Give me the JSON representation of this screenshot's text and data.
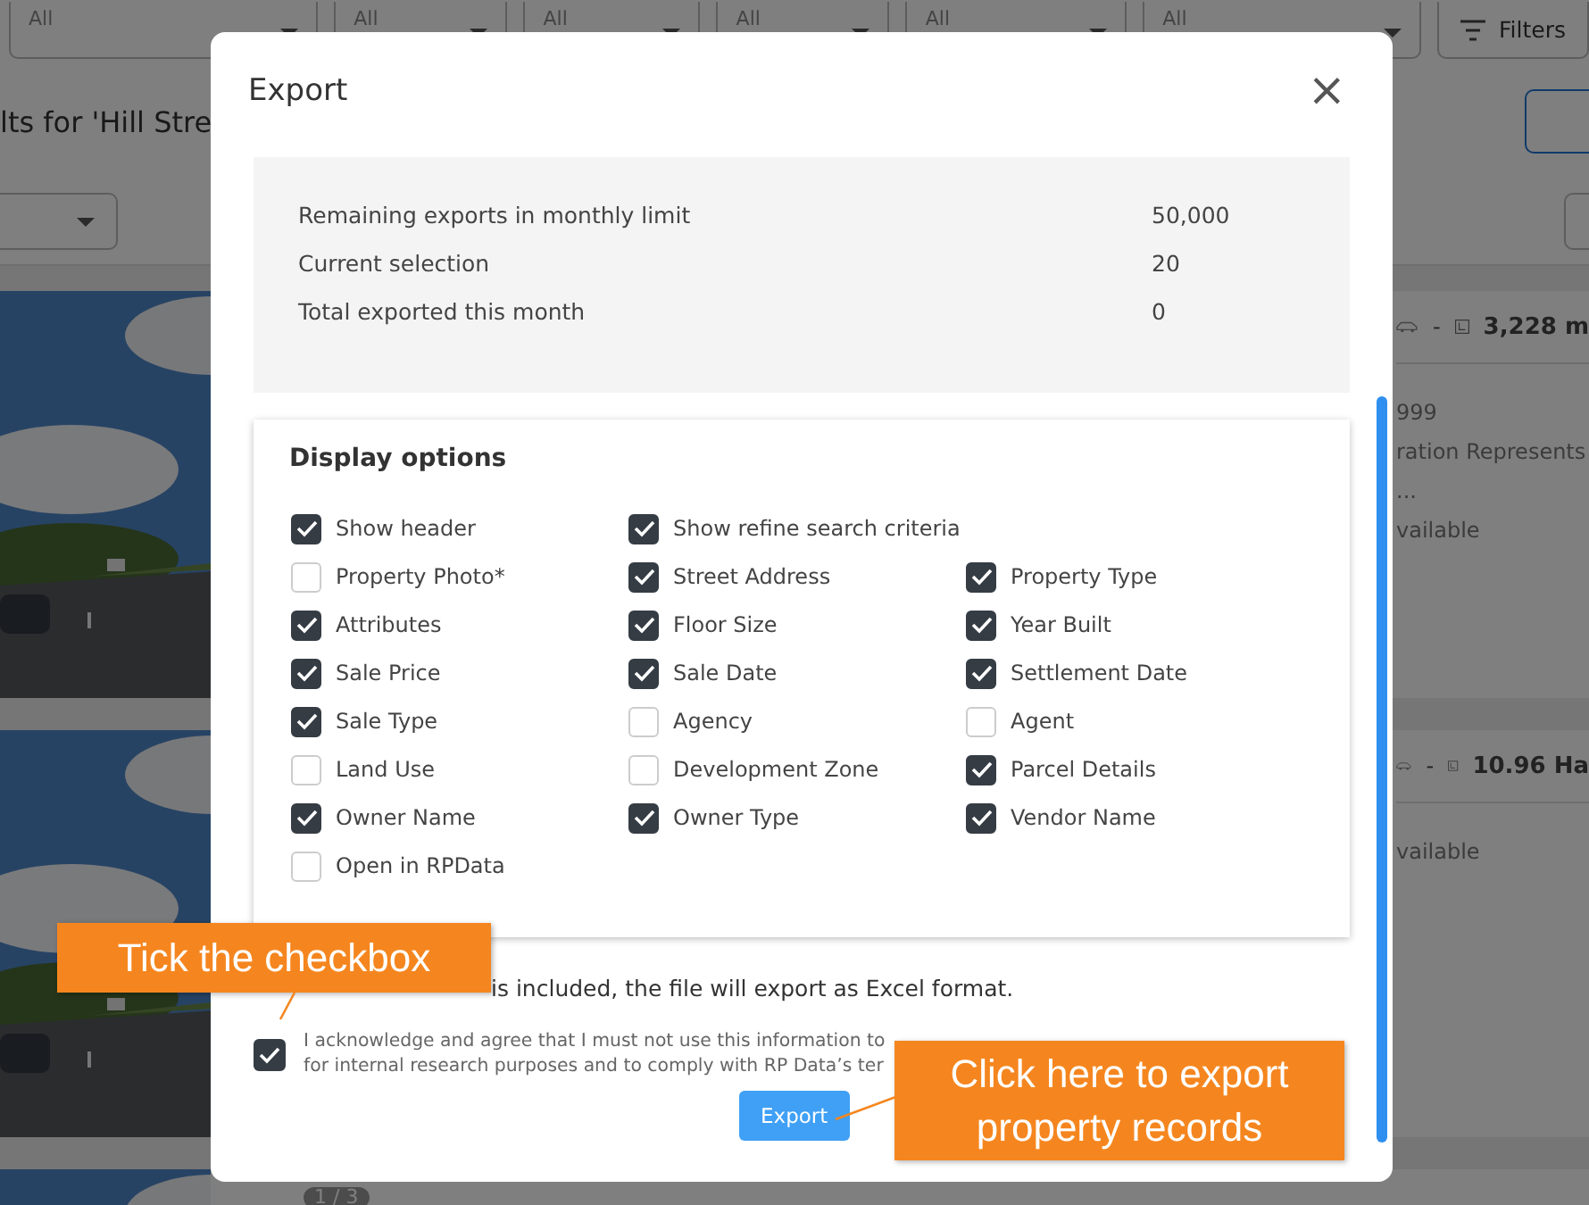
{
  "filters": [
    {
      "value": "All"
    },
    {
      "value": "All"
    },
    {
      "value": "All"
    },
    {
      "value": "All"
    },
    {
      "value": "All"
    },
    {
      "value": "All"
    }
  ],
  "filters_button": "Filters",
  "results_title": "lts for 'Hill Stre",
  "cards": [
    {
      "kind": "picture",
      "area": "3,228 m",
      "lines": [
        "999",
        "ration Represents",
        "...",
        "vailable"
      ],
      "separator": "-"
    },
    {
      "kind": "picture",
      "area": "10.96 Ha",
      "lines": [
        "vailable"
      ],
      "separator": "-"
    },
    {
      "kind": "picture",
      "counter": "1 / 3"
    }
  ],
  "dialog": {
    "title": "Export",
    "close": "×",
    "stats": [
      {
        "label": "Remaining exports in monthly limit",
        "value": "50,000"
      },
      {
        "label": "Current selection",
        "value": "20"
      },
      {
        "label": "Total exported this month",
        "value": "0"
      }
    ],
    "display_options": {
      "title": "Display options",
      "options": [
        {
          "label": "Show header",
          "checked": true
        },
        {
          "label": "Show refine search criteria",
          "checked": true
        },
        {
          "label": "Property Photo*",
          "checked": false
        },
        {
          "label": "Street Address",
          "checked": true
        },
        {
          "label": "Property Type",
          "checked": true
        },
        {
          "label": "Attributes",
          "checked": true
        },
        {
          "label": "Floor Size",
          "checked": true
        },
        {
          "label": "Year Built",
          "checked": true
        },
        {
          "label": "Sale Price",
          "checked": true
        },
        {
          "label": "Sale Date",
          "checked": true
        },
        {
          "label": "Settlement Date",
          "checked": true
        },
        {
          "label": "Sale Type",
          "checked": true
        },
        {
          "label": "Agency",
          "checked": false
        },
        {
          "label": "Agent",
          "checked": false
        },
        {
          "label": "Land Use",
          "checked": false
        },
        {
          "label": "Development Zone",
          "checked": false
        },
        {
          "label": "Parcel Details",
          "checked": true
        },
        {
          "label": "Owner Name",
          "checked": true
        },
        {
          "label": "Owner Type",
          "checked": true
        },
        {
          "label": "Vendor Name",
          "checked": true
        },
        {
          "label": "Open in RPData",
          "checked": false
        }
      ]
    },
    "note": "is included, the file will export as Excel format.",
    "agreement": {
      "checked": true,
      "lines": [
        "I acknowledge and agree that I must not use this information to",
        "for internal research purposes and to comply with RP Data’s ter"
      ]
    },
    "export_button": "Export"
  },
  "callouts": [
    {
      "text": "Tick the checkbox"
    },
    {
      "text": "Click here to export property records"
    }
  ]
}
